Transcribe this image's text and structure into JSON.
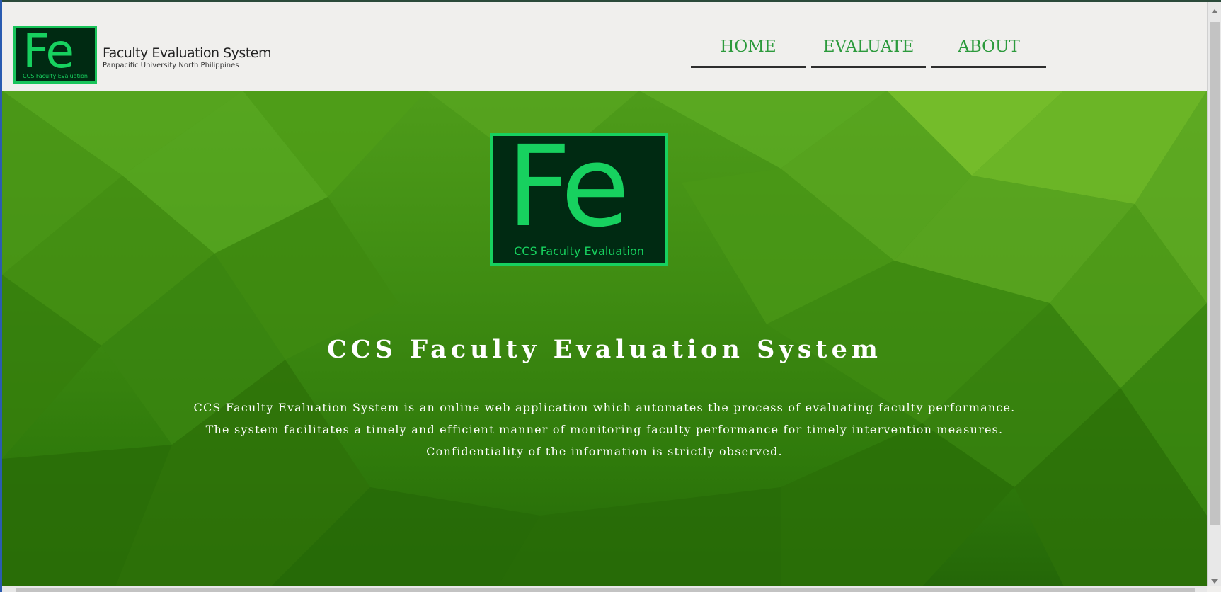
{
  "header": {
    "logo_text": "Fe",
    "logo_caption": "CCS Faculty Evaluation",
    "brand_title": "Faculty Evaluation System",
    "brand_subtitle": "Panpacific University North Philippines"
  },
  "nav": {
    "home": "HOME",
    "evaluate": "EVALUATE",
    "about": "ABOUT"
  },
  "hero": {
    "logo_text": "Fe",
    "logo_caption": "CCS Faculty Evaluation",
    "title": "CCS Faculty Evaluation System",
    "description_line1": "CCS Faculty Evaluation System is an online web application which automates the process of evaluating faculty performance.",
    "description_line2": "The system facilitates a timely and efficient manner of monitoring faculty performance for timely intervention measures.",
    "description_line3": "Confidentiality of the information is strictly observed."
  },
  "colors": {
    "accent_green": "#17d15f",
    "nav_text": "#2c9a3c",
    "hero_green": "#3f8c12"
  }
}
